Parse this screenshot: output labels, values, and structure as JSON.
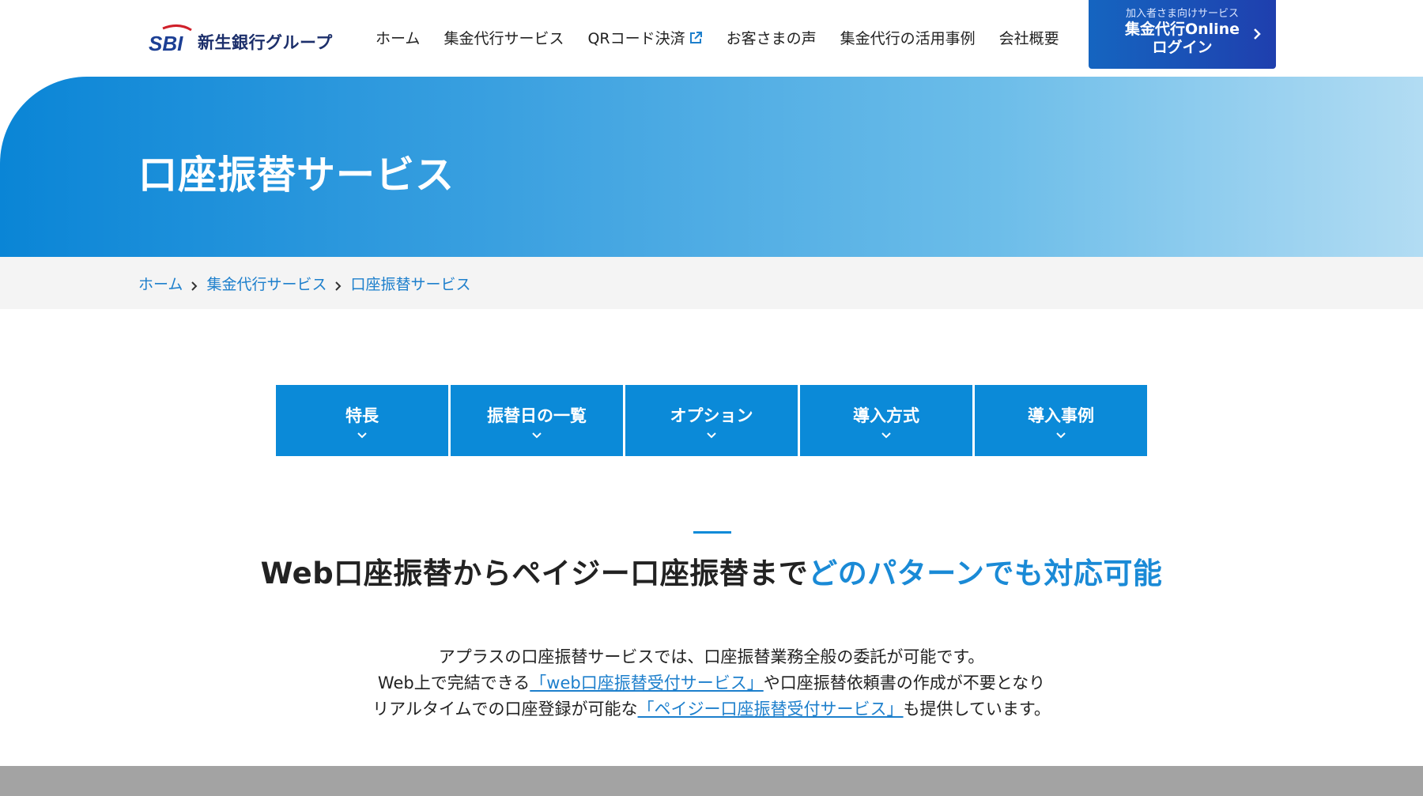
{
  "header": {
    "logo_mark": "SBI",
    "logo_text": "新生銀行グループ",
    "nav": [
      {
        "label": "ホーム"
      },
      {
        "label": "集金代行サービス"
      },
      {
        "label": "QRコード決済",
        "icon": "external-link-icon"
      },
      {
        "label": "お客さまの声"
      },
      {
        "label": "集金代行の活用事例"
      },
      {
        "label": "会社概要"
      }
    ],
    "login": {
      "sub": "加入者さま向けサービス",
      "line1": "集金代行Online",
      "line2": "ログイン"
    }
  },
  "hero": {
    "title": "口座振替サービス"
  },
  "breadcrumb": [
    "ホーム",
    "集金代行サービス",
    "口座振替サービス"
  ],
  "tabs": [
    {
      "label": "特長"
    },
    {
      "label": "振替日の一覧"
    },
    {
      "label": "オプション"
    },
    {
      "label": "導入方式"
    },
    {
      "label": "導入事例"
    }
  ],
  "section": {
    "title_plain": "Web口座振替からペイジー口座振替まで",
    "title_accent": "どのパターンでも対応可能",
    "line1": "アプラスの口座振替サービスでは、口座振替業務全般の委託が可能です。",
    "line2_pre": "Web上で完結できる",
    "line2_link": "「web口座振替受付サービス」",
    "line2_post": "や口座振替依頼書の作成が不要となり",
    "line3_pre": "リアルタイムでの口座登録が可能な",
    "line3_link": "「ペイジー口座振替受付サービス」",
    "line3_post": "も提供しています。"
  },
  "colors": {
    "accent": "#0b8ad8",
    "link": "#1d7fcc",
    "login_bg": "#1f3fae"
  }
}
